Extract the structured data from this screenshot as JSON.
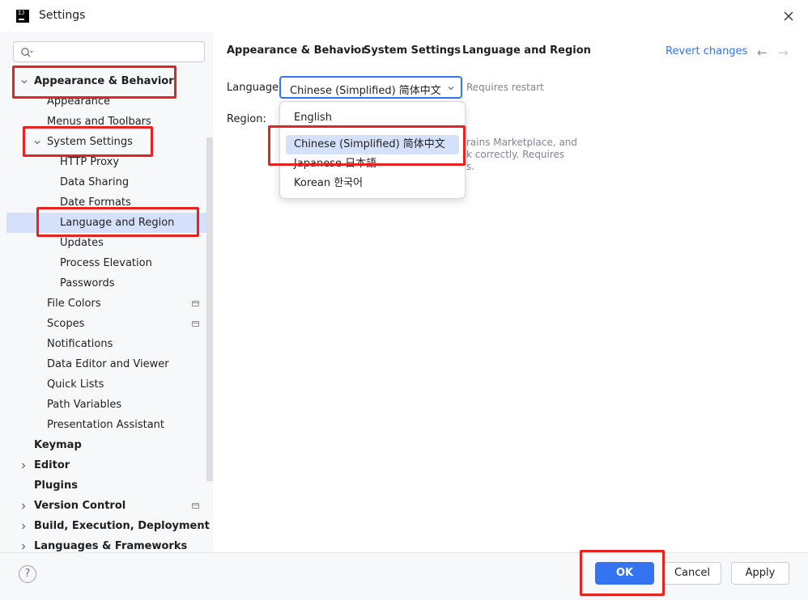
{
  "window": {
    "title": "Settings"
  },
  "search": {
    "placeholder": ""
  },
  "sidebar": {
    "items": [
      {
        "label": "Appearance & Behavior"
      },
      {
        "label": "Appearance"
      },
      {
        "label": "Menus and Toolbars"
      },
      {
        "label": "System Settings"
      },
      {
        "label": "HTTP Proxy"
      },
      {
        "label": "Data Sharing"
      },
      {
        "label": "Date Formats"
      },
      {
        "label": "Language and Region"
      },
      {
        "label": "Updates"
      },
      {
        "label": "Process Elevation"
      },
      {
        "label": "Passwords"
      },
      {
        "label": "File Colors"
      },
      {
        "label": "Scopes"
      },
      {
        "label": "Notifications"
      },
      {
        "label": "Data Editor and Viewer"
      },
      {
        "label": "Quick Lists"
      },
      {
        "label": "Path Variables"
      },
      {
        "label": "Presentation Assistant"
      },
      {
        "label": "Keymap"
      },
      {
        "label": "Editor"
      },
      {
        "label": "Plugins"
      },
      {
        "label": "Version Control"
      },
      {
        "label": "Build, Execution, Deployment"
      },
      {
        "label": "Languages & Frameworks"
      }
    ]
  },
  "breadcrumb": [
    "Appearance & Behavior",
    "System Settings",
    "Language and Region"
  ],
  "header": {
    "revert": "Revert changes",
    "back": "←",
    "forward": "→"
  },
  "form": {
    "language_label": "Language:",
    "language_value": "Chinese (Simplified) 简体中文",
    "requires_restart": "Requires restart",
    "region_label": "Region:",
    "region_desc_line1": "rains Marketplace, and",
    "region_desc_line2": "k correctly. Requires",
    "region_desc_line3": "s."
  },
  "dropdown": {
    "options": [
      {
        "label": "English"
      },
      {
        "label": "Chinese (Simplified) 简体中文"
      },
      {
        "label": "Japanese 日本語"
      },
      {
        "label": "Korean 한국어"
      }
    ]
  },
  "footer": {
    "help": "?",
    "ok": "OK",
    "cancel": "Cancel",
    "apply": "Apply"
  },
  "colors": {
    "accent": "#3574f0",
    "highlight": "#e8231f",
    "selection": "#d5e1fb"
  }
}
